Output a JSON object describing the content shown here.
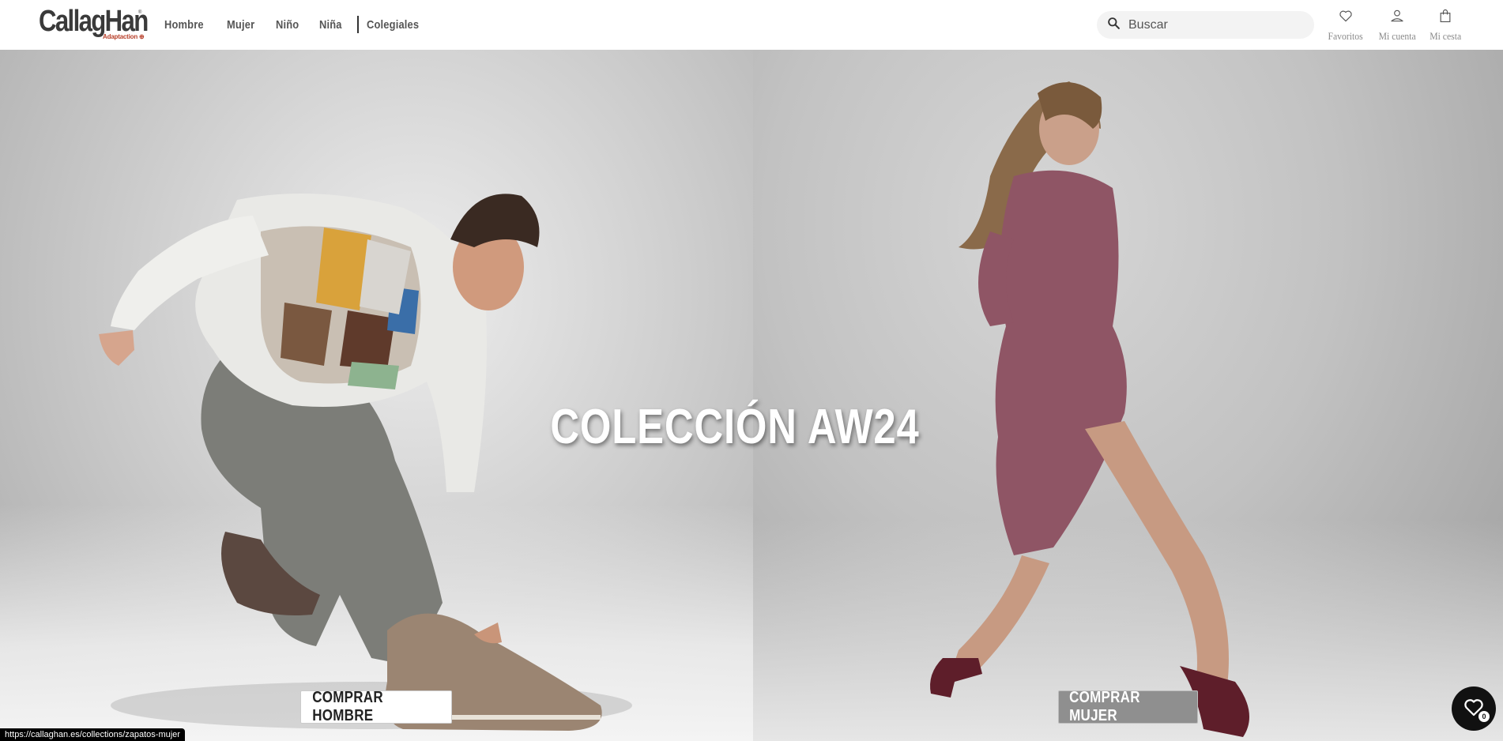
{
  "brand": {
    "name": "CallagHan",
    "tagline": "Adaptaction ⊕",
    "registered": "®",
    "logo_color": "#3a3a3a",
    "accent_color": "#b8402a"
  },
  "nav": {
    "items": [
      {
        "label": "Hombre"
      },
      {
        "label": "Mujer"
      },
      {
        "label": "Niño"
      },
      {
        "label": "Niña"
      },
      {
        "label": "Colegiales"
      }
    ]
  },
  "search": {
    "placeholder": "Buscar",
    "value": "",
    "icon": "search-icon"
  },
  "header_actions": {
    "favorites": {
      "label": "Favoritos",
      "icon": "heart-icon"
    },
    "account": {
      "label": "Mi cuenta",
      "icon": "user-icon"
    },
    "cart": {
      "label": "Mi cesta",
      "icon": "shopping-bag-icon"
    }
  },
  "hero": {
    "title": "COLECCIÓN AW24",
    "left_cta": "COMPRAR HOMBRE",
    "right_cta": "COMPRAR MUJER"
  },
  "status_bar": {
    "url": "https://callaghan.es/collections/zapatos-mujer"
  },
  "wishlist_fab": {
    "icon": "heart-icon",
    "count": "0"
  }
}
